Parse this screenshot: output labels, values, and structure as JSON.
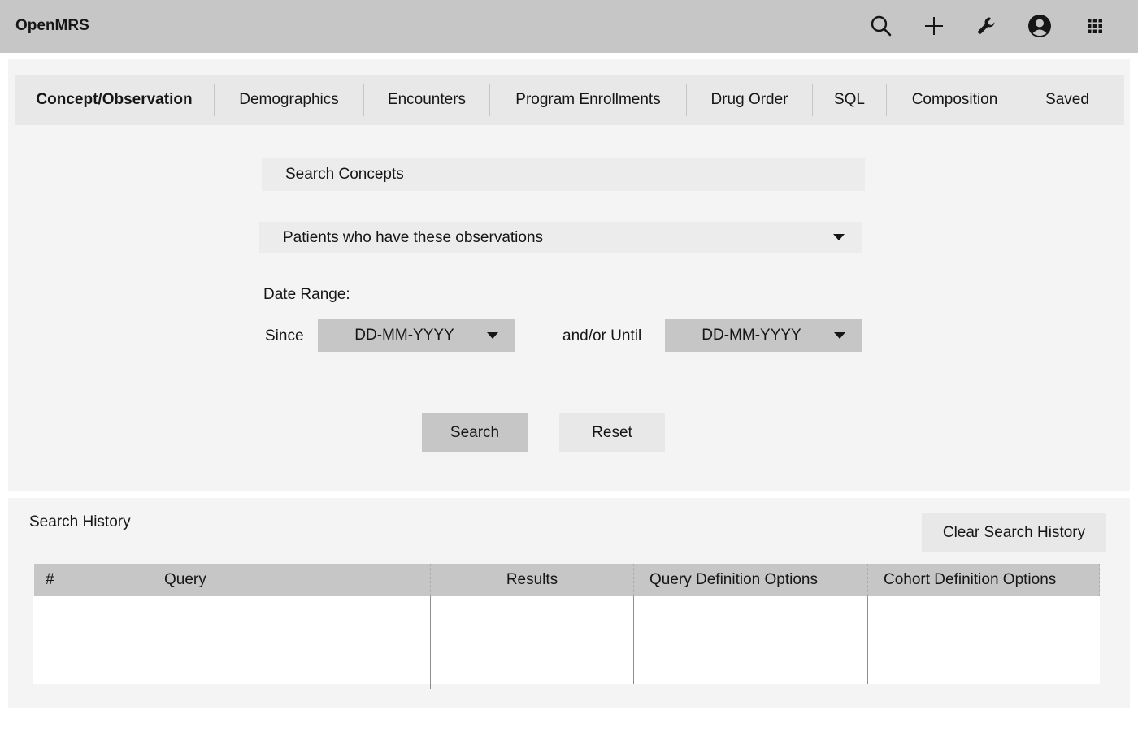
{
  "header": {
    "brand": "OpenMRS",
    "icons": [
      "search-icon",
      "add-icon",
      "wrench-icon",
      "user-avatar-icon",
      "app-switcher-icon"
    ]
  },
  "tabs": [
    {
      "label": "Concept/Observation",
      "active": true
    },
    {
      "label": "Demographics",
      "active": false
    },
    {
      "label": "Encounters",
      "active": false
    },
    {
      "label": "Program Enrollments",
      "active": false
    },
    {
      "label": "Drug Order",
      "active": false
    },
    {
      "label": "SQL",
      "active": false
    },
    {
      "label": "Composition",
      "active": false
    },
    {
      "label": "Saved",
      "active": false
    }
  ],
  "form": {
    "search_placeholder": "Search Concepts",
    "observation_select": "Patients who have these observations",
    "date_range_label": "Date Range:",
    "since_label": "Since",
    "since_value": "DD-MM-YYYY",
    "until_label": "and/or Until",
    "until_value": "DD-MM-YYYY",
    "search_button": "Search",
    "reset_button": "Reset"
  },
  "history": {
    "title": "Search History",
    "clear_button": "Clear Search History",
    "columns": [
      "#",
      "Query",
      "Results",
      "Query Definition Options",
      "Cohort Definition Options"
    ],
    "rows": []
  },
  "colors": {
    "header_bg": "#c6c6c6",
    "panel_bg": "#f4f4f4",
    "tab_bar_bg": "#e8e8e8",
    "primary_button_bg": "#c6c6c6",
    "secondary_button_bg": "#e8e8e8"
  }
}
